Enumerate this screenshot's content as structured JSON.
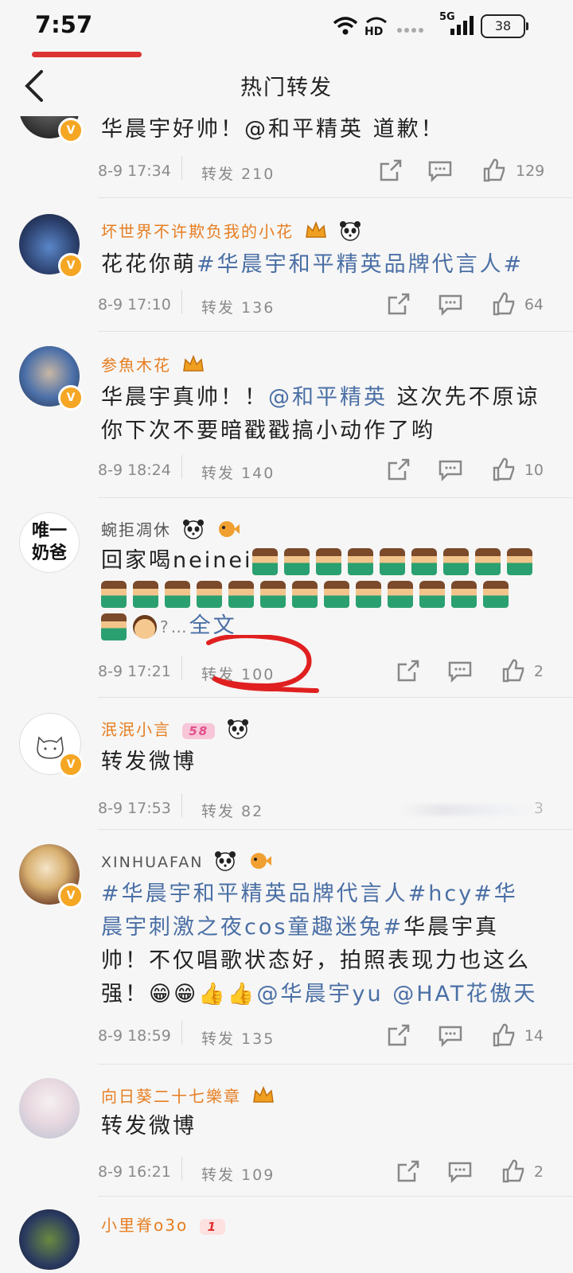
{
  "status_bar": {
    "time": "7:57",
    "network": "5G",
    "hd": "HD",
    "battery": "38"
  },
  "nav": {
    "title": "热门转发"
  },
  "posts": [
    {
      "text": "华晨宇好帅！@和平精英 道歉！",
      "date": "8-9 17:34",
      "forwards": "转发 210",
      "likes": "129"
    },
    {
      "name": "坏世界不许欺负我的小花",
      "text_plain": "花花你萌",
      "text_tag": "#华晨宇和平精英品牌代言人#",
      "date": "8-9 17:10",
      "forwards": "转发 136",
      "likes": "64"
    },
    {
      "name": "参魚木花",
      "text_a": "华晨宇真帅！！",
      "text_mention": "@和平精英",
      "text_b": " 这次先不原谅你下次不要暗戳戳搞小动作了哟",
      "date": "8-9 18:24",
      "forwards": "转发 140",
      "likes": "10"
    },
    {
      "name": "蜿拒凋休",
      "avatar_text": "唯一\n奶爸",
      "text": "回家喝neinei",
      "more": "?…",
      "full_text": "全文",
      "date": "8-9 17:21",
      "forwards": "转发 100",
      "likes": "2"
    },
    {
      "name": "泯泯小言",
      "level_badge": "58",
      "text": "转发微博",
      "date": "8-9 17:53",
      "forwards": "转发 82",
      "likes": "3"
    },
    {
      "name": "XINHUAFAN",
      "text_tag1": "#华晨宇和平精英品牌代言人#",
      "text_tag2": "hcy",
      "text_tag3": "#华晨宇刺激之夜cos童趣迷兔#",
      "text_a": "华晨宇真帅！不仅唱歌状态好，拍照表现力也这么强！",
      "text_emoji": "😁😁👍👍",
      "text_mention1": "@华晨宇yu",
      "text_mention2": "@HAT花傲天",
      "date": "8-9 18:59",
      "forwards": "转发 135",
      "likes": "14"
    },
    {
      "name": "向日葵二十七樂章",
      "text": "转发微博",
      "date": "8-9 16:21",
      "forwards": "转发 109",
      "likes": "2"
    },
    {
      "name": "小里脊o3o",
      "level_badge": "1"
    }
  ],
  "colors": {
    "accent_name": "#e67e22",
    "link": "#4a6fa5",
    "annotation_red": "#e02020"
  },
  "icons": [
    "back-arrow-icon",
    "share-icon",
    "comment-icon",
    "like-icon",
    "verified-badge-icon",
    "panda-icon",
    "crown-badge-icon",
    "puffer-fish-icon"
  ]
}
